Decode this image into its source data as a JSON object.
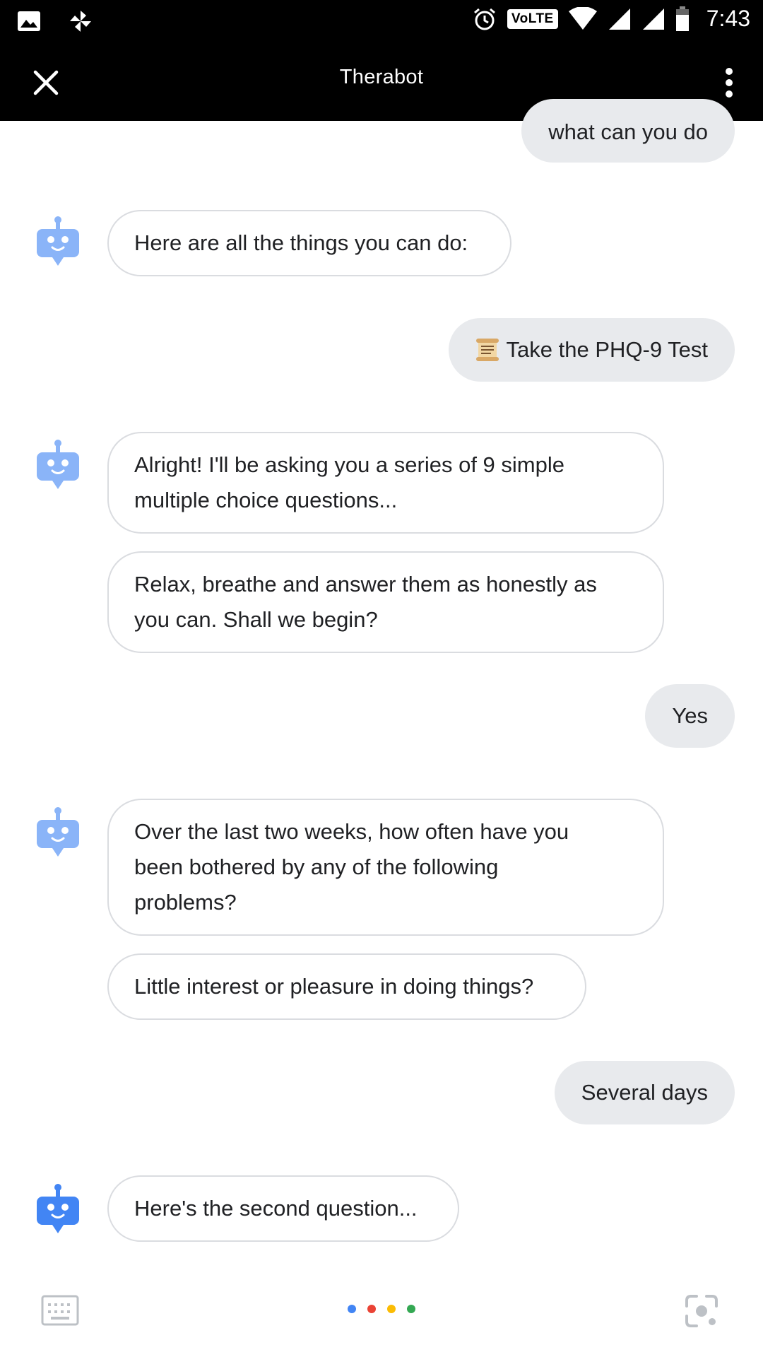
{
  "status_bar": {
    "time": "7:43",
    "volte": "VoLTE",
    "icons": [
      "image-icon",
      "pinwheel-icon",
      "alarm-icon",
      "wifi-icon",
      "signal-icon",
      "signal-icon",
      "battery-icon"
    ]
  },
  "app_bar": {
    "title": "Therabot"
  },
  "messages": [
    {
      "from": "user",
      "text": "what can you do"
    },
    {
      "from": "bot",
      "text": "Here are all the things you can do:"
    },
    {
      "from": "user",
      "icon": "scroll-icon",
      "text": "Take the PHQ-9 Test"
    },
    {
      "from": "bot",
      "text": "Alright! I'll be asking you a series of 9 simple multiple choice questions..."
    },
    {
      "from": "bot",
      "text": "Relax, breathe and answer them as honestly as you can. Shall we begin?"
    },
    {
      "from": "user",
      "text": "Yes"
    },
    {
      "from": "bot",
      "text": "Over the last two weeks, how often have you been bothered by any of the following problems?"
    },
    {
      "from": "bot",
      "text": "Little interest or pleasure in doing things?"
    },
    {
      "from": "user",
      "text": "Several days"
    },
    {
      "from": "bot",
      "text": "Here's the second question..."
    }
  ],
  "colors": {
    "bot_avatar_faded": "#8ab4f8",
    "bot_avatar_active": "#4285f4",
    "user_bubble": "#e8eaed",
    "bot_bubble_border": "#dadce0",
    "dot_blue": "#4285f4",
    "dot_red": "#ea4335",
    "dot_yellow": "#fbbc04",
    "dot_green": "#34a853"
  }
}
